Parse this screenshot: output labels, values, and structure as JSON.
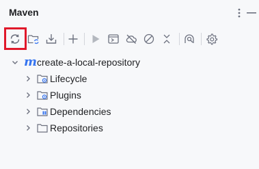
{
  "window": {
    "title": "Maven"
  },
  "tree": {
    "root": {
      "label": "create-a-local-repository",
      "icon": "maven-m-icon"
    },
    "children": [
      {
        "label": "Lifecycle",
        "icon": "folder-gear-icon"
      },
      {
        "label": "Plugins",
        "icon": "folder-gear-icon"
      },
      {
        "label": "Dependencies",
        "icon": "folder-library-icon"
      },
      {
        "label": "Repositories",
        "icon": "folder-icon"
      }
    ]
  },
  "colors": {
    "accent": "#3574f0",
    "highlight": "#e0182a",
    "icon": "#6c707e",
    "disabled": "#b4b8bf"
  }
}
